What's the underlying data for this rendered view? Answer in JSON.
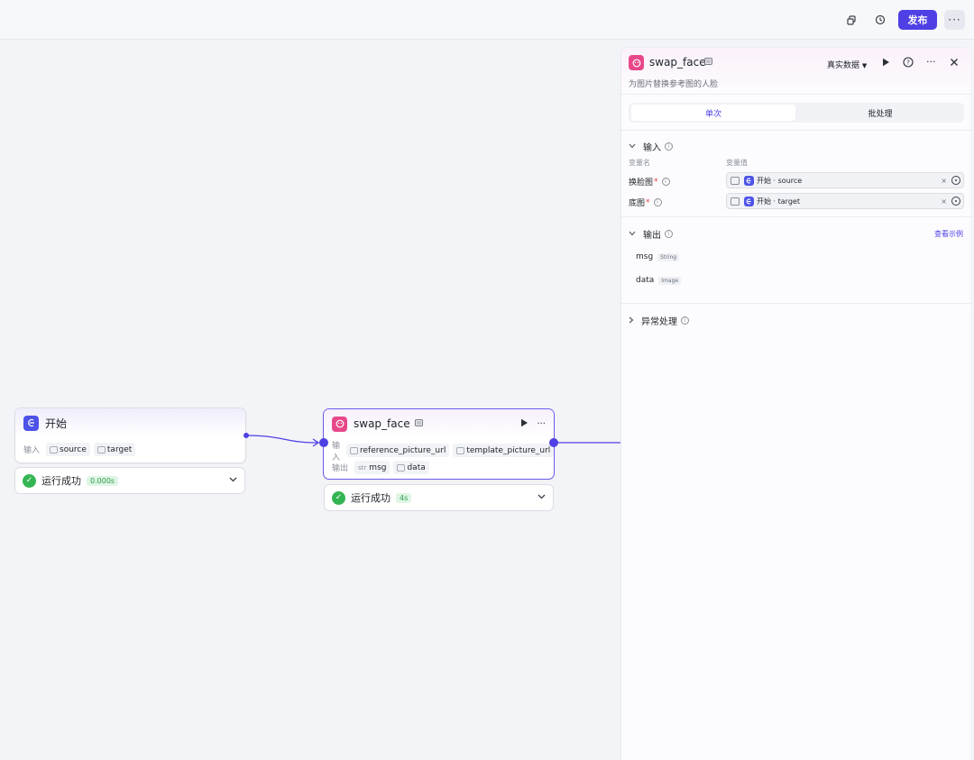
{
  "topbar": {
    "copy_icon": "copy-icon",
    "history_icon": "history-icon",
    "publish_label": "发布",
    "more_label": "···"
  },
  "canvas": {
    "start_node": {
      "title": "开始",
      "input_label": "输入",
      "inputs": [
        "source",
        "target"
      ],
      "status_text": "运行成功",
      "status_time": "0.000s"
    },
    "swap_node": {
      "title": "swap_face",
      "input_label": "输入",
      "inputs": [
        "reference_picture_url",
        "template_picture_url"
      ],
      "output_label": "输出",
      "outputs": [
        {
          "type": "str",
          "name": "msg"
        },
        {
          "type": "img",
          "name": "data"
        }
      ],
      "status_text": "运行成功",
      "status_time": "4s"
    },
    "colors": {
      "accent": "#4e40e5",
      "start_icon": "#4d53e8",
      "plugin_icon": "#e8488a",
      "success": "#34b553"
    }
  },
  "panel": {
    "title": "swap_face",
    "description": "为图片替换参考图的人脸",
    "mode_label": "真实数据",
    "tabs": [
      "单次",
      "批处理"
    ],
    "input_section": {
      "title": "输入",
      "col_name": "变量名",
      "col_value": "变量值",
      "rows": [
        {
          "name": "换脸图",
          "ref_text": "开始 · source"
        },
        {
          "name": "底图",
          "ref_text": "开始 · target"
        }
      ]
    },
    "output_section": {
      "title": "输出",
      "view_example": "查看示例",
      "rows": [
        {
          "name": "msg",
          "type": "String"
        },
        {
          "name": "data",
          "type": "Image"
        }
      ]
    },
    "error_section": {
      "title": "异常处理"
    }
  }
}
